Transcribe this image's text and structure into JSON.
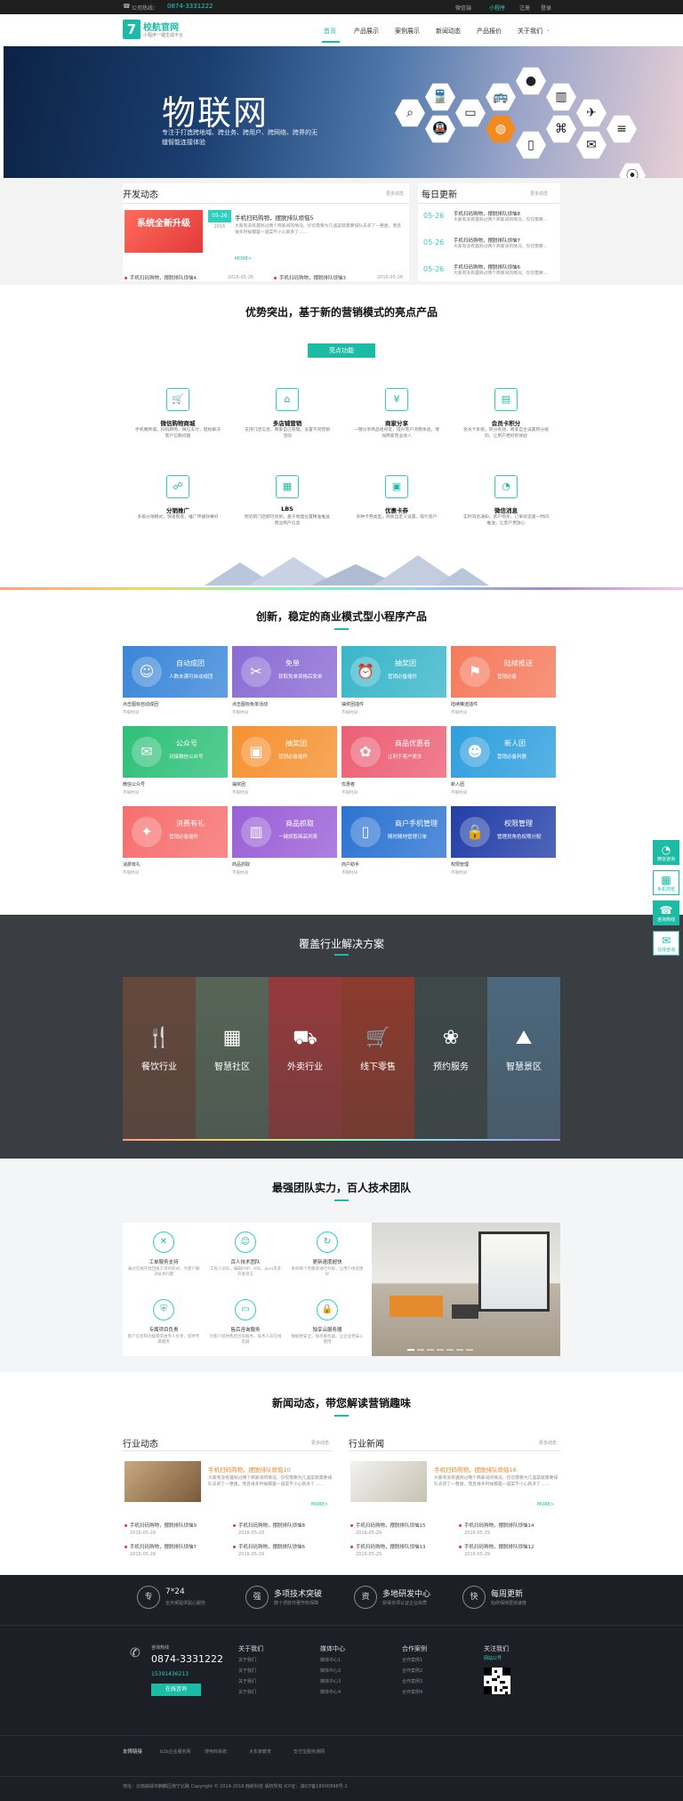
{
  "topbar": {
    "phone_label": "公司热线：",
    "phone": "0874-3331222",
    "links": [
      "微信端",
      "小程序",
      "注册",
      "登录"
    ]
  },
  "header": {
    "logo_mark": "7",
    "logo_title": "校航官网",
    "logo_sub": "小程序一键生成平台",
    "nav": [
      "首页",
      "产品展示",
      "案例展示",
      "新闻动态",
      "产品报价",
      "关于我们"
    ]
  },
  "banner": {
    "title": "物联网",
    "subtitle": "专注于打造跨地域、跨业务、跨用户、跨网络、跨界的无缝智能连接体验",
    "icons": [
      "search-icon",
      "train-icon",
      "monitor-icon",
      "bus-icon",
      "user-icon",
      "chart-icon",
      "plane-icon",
      "globe-icon",
      "phone-icon",
      "map-icon",
      "mail-icon",
      "location-icon",
      "bars-icon",
      "train2-icon"
    ]
  },
  "dev_news": {
    "title": "开发动态",
    "more": "更多动态",
    "banner_text": "系统全新升级",
    "feature": {
      "date": "05-26",
      "year": "2016",
      "title": "手机扫码购物，摆脱排队烦恼5",
      "desc": "大家有没有遇到过两个商家间的情况，仅仅需要为几道菜就需要排队去买了一整盘，而且很多时候都是一道菜不小心就多了……",
      "more": "MORE>"
    },
    "list": [
      {
        "title": "手机扫码购物，摆脱排队烦恼4",
        "date": "2016-05-26"
      },
      {
        "title": "手机扫码购物，摆脱排队烦恼3",
        "date": "2016-05-26"
      }
    ]
  },
  "daily": {
    "title": "每日更新",
    "more": "更多动态",
    "items": [
      {
        "date": "05-26",
        "title": "手机扫码购物，摆脱排队烦恼8",
        "desc": "大家有没有遇到过两个商家间的情况，仅仅需要..."
      },
      {
        "date": "05-26",
        "title": "手机扫码购物，摆脱排队烦恼7",
        "desc": "大家有没有遇到过两个商家间的情况，仅仅需要..."
      },
      {
        "date": "05-26",
        "title": "手机扫码购物，摆脱排队烦恼6",
        "desc": "大家有没有遇到过两个商家间的情况，仅仅需要..."
      }
    ]
  },
  "features": {
    "title": "优势突出，基于新的营销模式的亮点产品",
    "button": "亮点功能",
    "items": [
      {
        "icon": "cart-icon",
        "name": "微信购物商城",
        "desc": "手机端商城，扫码即购，微信支付，轻松解决客户信赖问题"
      },
      {
        "icon": "home-icon",
        "name": "多店铺营销",
        "desc": "支持门店信息，商家自己管理，设置不同营销活动"
      },
      {
        "icon": "money-icon",
        "name": "商家分享",
        "desc": "一键分享商品给好友，提升客户消费体验，增加商家营业收入"
      },
      {
        "icon": "card-icon",
        "name": "会员卡积分",
        "desc": "会员卡系统，积分有效，商家自主设置积分规则，让用户更好的体验"
      },
      {
        "icon": "team-icon",
        "name": "分销推广",
        "desc": "多级分销模式，快速裂变，推广传播效果好"
      },
      {
        "icon": "chart-icon",
        "name": "LBS",
        "desc": "附近的门店即可找到，基于地理位置精准推送周边商户信息"
      },
      {
        "icon": "coupon-icon",
        "name": "优惠卡券",
        "desc": "多种卡券类型，商家自定义设置，吸引客户"
      },
      {
        "icon": "wechat-icon",
        "name": "微信消息",
        "desc": "实时消息通知，客户购买、订单状态第一时间推送，让客户更放心"
      }
    ]
  },
  "products": {
    "title": "创新，稳定的商业模式型小程序产品",
    "items": [
      {
        "icon": "group-icon",
        "name": "自动成团",
        "desc": "人数未满可自动成团",
        "caption": "点击图标自动成团",
        "color": "#3a86d8"
      },
      {
        "icon": "ticket-icon",
        "name": "免单",
        "desc": "获取免单资格后免单",
        "caption": "点击图标免单活动",
        "color": "#8a6cd4"
      },
      {
        "icon": "alarm-icon",
        "name": "抽奖团",
        "desc": "营销必备插件",
        "caption": "抽奖团插件",
        "color": "#39b6c9"
      },
      {
        "icon": "flag-icon",
        "name": "陆续推送",
        "desc": "营销必备",
        "caption": "陆续推送插件",
        "color": "#f57a5c"
      },
      {
        "icon": "chat-icon",
        "name": "公众号",
        "desc": "对接微信公众号",
        "caption": "微信公众号",
        "color": "#2ec079"
      },
      {
        "icon": "bag-icon",
        "name": "抽奖团",
        "desc": "营销必备插件",
        "caption": "抽奖团",
        "color": "#f59130"
      },
      {
        "icon": "coupon-icon",
        "name": "商品优惠卷",
        "desc": "让利于客户更多",
        "caption": "优惠卷",
        "color": "#ec5f75"
      },
      {
        "icon": "person-icon",
        "name": "新人团",
        "desc": "营销必备利器",
        "caption": "新人团",
        "color": "#2f9fde"
      },
      {
        "icon": "gift-icon",
        "name": "消费有礼",
        "desc": "营销必备插件",
        "caption": "消费有礼",
        "color": "#f76e6e"
      },
      {
        "icon": "box-icon",
        "name": "商品抓取",
        "desc": "一键抓取商品列表",
        "caption": "商品抓取",
        "color": "#9a5fd6"
      },
      {
        "icon": "mobile-icon",
        "name": "商户手机管理",
        "desc": "随时随地管理订单",
        "caption": "商户助手",
        "color": "#2b73d1"
      },
      {
        "icon": "lock-icon",
        "name": "权限管理",
        "desc": "管理员角色权限分配",
        "caption": "权限管理",
        "color": "#233fa8"
      }
    ],
    "sub_caption": "不限时间"
  },
  "solutions": {
    "title": "覆盖行业解决方案",
    "items": [
      {
        "icon": "dining-icon",
        "label": "餐饮行业",
        "color": "#6b4a3a"
      },
      {
        "icon": "building-icon",
        "label": "智慧社区",
        "color": "#5b6b5a"
      },
      {
        "icon": "scooter-icon",
        "label": "外卖行业",
        "color": "#a33a3a"
      },
      {
        "icon": "cart-icon",
        "label": "线下零售",
        "color": "#9a3a2a"
      },
      {
        "icon": "lotus-icon",
        "label": "预约服务",
        "color": "#3f4a4a"
      },
      {
        "icon": "landscape-icon",
        "label": "智慧景区",
        "color": "#4f6f86"
      }
    ]
  },
  "team": {
    "title": "最强团队实力，百人技术团队",
    "items": [
      {
        "icon": "tools-icon",
        "name": "工单服务支持",
        "desc": "通过在线开放回拨工单的形式，为客户解决技术问题"
      },
      {
        "icon": "people-icon",
        "name": "百人技术团队",
        "desc": "工程人员队，编辑PHP、IOS、Java等多开发语言"
      },
      {
        "icon": "refresh-icon",
        "name": "更新速度超快",
        "desc": "系统每个月都会进行升级，让用户体验更好"
      },
      {
        "icon": "shield-icon",
        "name": "专属项目负责",
        "desc": "客户信息和功能需求由专人负责，提供专属服务"
      },
      {
        "icon": "screen-icon",
        "name": "售后咨询服务",
        "desc": "为客户提供售后咨询服务，技术人员在线答疑"
      },
      {
        "icon": "lock-icon",
        "name": "独享云服务器",
        "desc": "数据更安全，独享服务器，让企业更安心使用"
      }
    ]
  },
  "news": {
    "title": "新闻动态，带您解读营销趣味",
    "industry": {
      "title": "行业动态",
      "more": "更多动态",
      "feature": {
        "title": "手机扫码购物，摆脱排队烦恼10",
        "desc": "大家有没有遇到过两个商家间的情况，仅仅需要为几道菜就需要排队去买了一整盘，而且很多时候都是一道菜不小心就多了……",
        "more": "MORE>"
      },
      "list": [
        {
          "title": "手机扫码购物，摆脱排队烦恼9",
          "date": "2016-05-29"
        },
        {
          "title": "手机扫码购物，摆脱排队烦恼8",
          "date": "2016-05-29"
        },
        {
          "title": "手机扫码购物，摆脱排队烦恼7",
          "date": "2016-05-29"
        },
        {
          "title": "手机扫码购物，摆脱排队烦恼6",
          "date": "2016-05-29"
        }
      ]
    },
    "company": {
      "title": "行业新闻",
      "more": "更多动态",
      "feature": {
        "title": "手机扫码购物，摆脱排队烦恼16",
        "desc": "大家有没有遇到过两个商家间的情况，仅仅需要为几道菜就需要排队去买了一整盘，而且很多时候都是一道菜不小心就多了……",
        "more": "MORE>"
      },
      "list": [
        {
          "title": "手机扫码购物，摆脱排队烦恼15",
          "date": "2016-05-29"
        },
        {
          "title": "手机扫码购物，摆脱排队烦恼14",
          "date": "2016-05-29"
        },
        {
          "title": "手机扫码购物，摆脱排队烦恼13",
          "date": "2016-05-29"
        },
        {
          "title": "手机扫码购物，摆脱排队烦恼12",
          "date": "2016-05-29"
        }
      ]
    }
  },
  "services": [
    {
      "icon_text": "专",
      "title": "7*24",
      "desc": "全天候提供贴心服务"
    },
    {
      "icon_text": "强",
      "title": "多项技术突破",
      "desc": "数十项软件著作权保障"
    },
    {
      "icon_text": "资",
      "title": "多地研发中心",
      "desc": "获得多项认证企业资质"
    },
    {
      "icon_text": "快",
      "title": "每周更新",
      "desc": "始终保持更快速度"
    }
  ],
  "footer": {
    "hotline_label": "咨询热线",
    "hotline": "0874-3331222",
    "mobile": "15391436213",
    "online_btn": "在线咨询",
    "columns": [
      {
        "title": "关于我们",
        "links": [
          "关于我们",
          "关于我们",
          "关于我们",
          "关于我们"
        ]
      },
      {
        "title": "媒体中心",
        "links": [
          "媒体中心1",
          "媒体中心2",
          "媒体中心3",
          "媒体中心4"
        ]
      },
      {
        "title": "合作案例",
        "links": [
          "合作案例1",
          "合作案例2",
          "合作案例3",
          "合作案例4"
        ]
      }
    ],
    "follow_title": "关注我们",
    "follow_sub": "网站公号",
    "friend_label": "友情链接",
    "friend_links": [
      "b2b企业服务网",
      "搜电商系统",
      "大东家教育",
      "支付宝服务通网"
    ],
    "copyright": "地址：云南曲靖市麒麟区南宁北路  Copyright © 2014-2018 韩航科技 版权所有  ICP证：滇ICP备18000898号-1"
  },
  "side": [
    {
      "icon": "wechat-icon",
      "label": "微信咨询"
    },
    {
      "icon": "qr-icon",
      "label": "手机浏览"
    },
    {
      "icon": "phone-icon",
      "label": "咨询热线"
    },
    {
      "icon": "chat-icon",
      "label": "在线咨询"
    }
  ]
}
